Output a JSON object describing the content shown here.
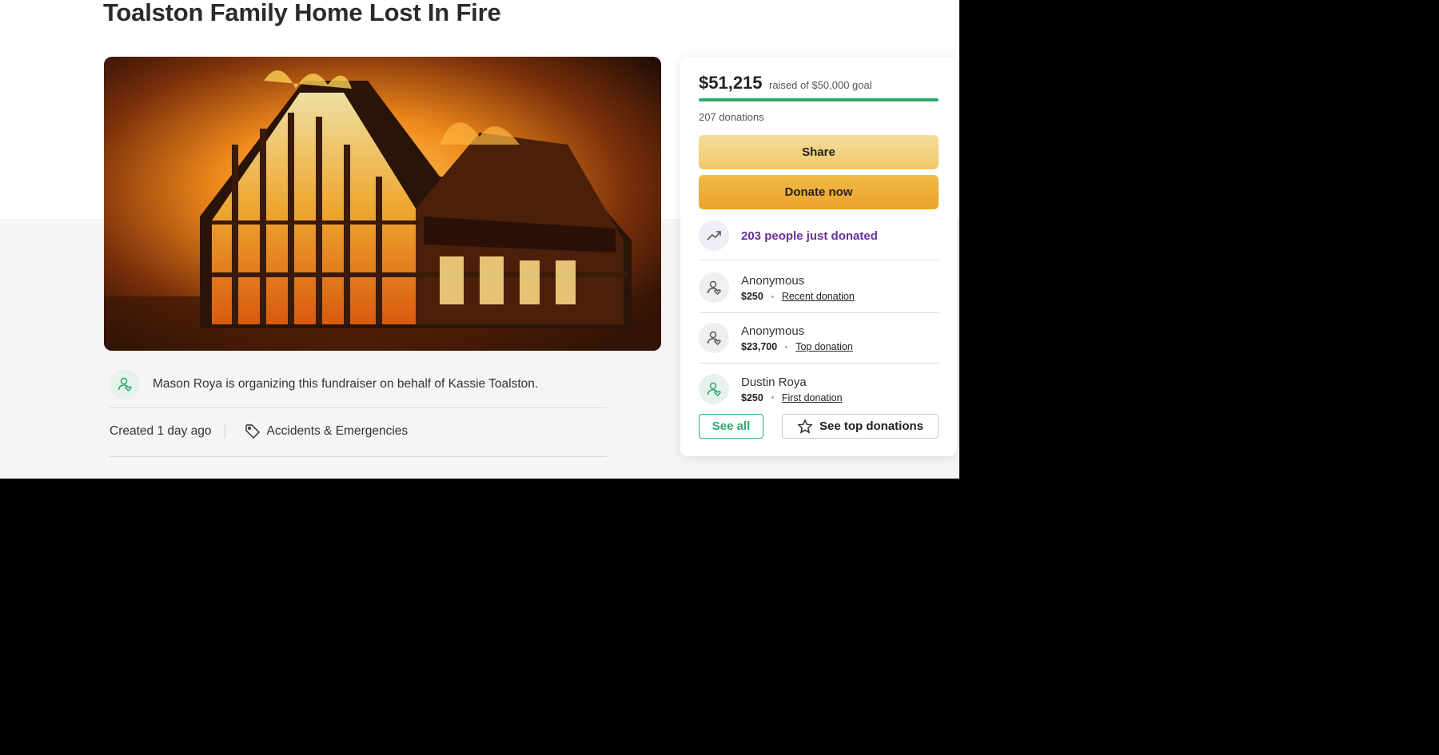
{
  "campaign": {
    "title": "Toalston Family Home Lost In Fire",
    "hero_image": "burning-house-photo",
    "organizer_text": "Mason Roya is organizing this fundraiser on behalf of Kassie Toalston.",
    "created": "Created 1 day ago",
    "category": "Accidents & Emergencies"
  },
  "donation_card": {
    "raised": "$51,215",
    "goal_text": "raised of $50,000 goal",
    "progress_fraction": 1.0,
    "donations_count": "207 donations",
    "share_label": "Share",
    "donate_label": "Donate now",
    "trending_text": "203 people just donated",
    "donors": [
      {
        "name": "Anonymous",
        "amount": "$250",
        "tag": "Recent donation"
      },
      {
        "name": "Anonymous",
        "amount": "$23,700",
        "tag": "Top donation"
      },
      {
        "name": "Dustin Roya",
        "amount": "$250",
        "tag": "First donation"
      }
    ],
    "see_all_label": "See all",
    "see_top_label": "See top donations"
  },
  "colors": {
    "accent_green": "#2bac6d",
    "trend_purple": "#6b2f9c",
    "share_yellow": "#f5dc9a",
    "donate_orange": "#eaa32e"
  },
  "icons": [
    "user-heart-icon",
    "tag-icon",
    "trending-up-icon",
    "star-icon"
  ]
}
